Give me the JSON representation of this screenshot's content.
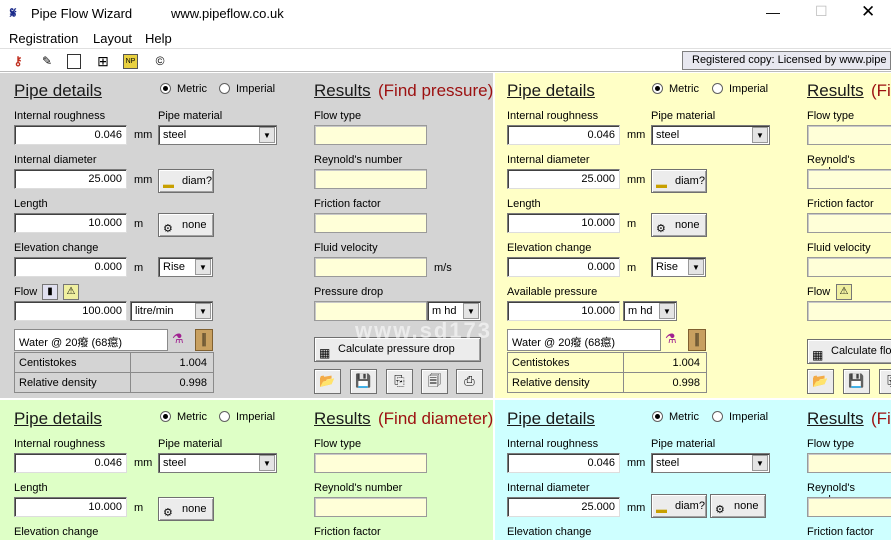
{
  "window": {
    "title": "Pipe Flow Wizard",
    "url": "www.pipeflow.co.uk"
  },
  "menu": {
    "items": [
      "Registration",
      "Layout",
      "Help"
    ]
  },
  "registered": "Registered copy: Licensed by www.pipe",
  "common": {
    "pipe_details": "Pipe details",
    "results": "Results",
    "metric": "Metric",
    "imperial": "Imperial",
    "internal_roughness": "Internal roughness",
    "pipe_material": "Pipe material",
    "internal_diameter": "Internal diameter",
    "length": "Length",
    "elevation_change": "Elevation change",
    "flow": "Flow",
    "available_pressure": "Available pressure",
    "flow_type": "Flow type",
    "reynolds": "Reynold's number",
    "friction": "Friction factor",
    "velocity": "Fluid velocity",
    "pressure_drop": "Pressure drop",
    "diam_btn": "diam?",
    "none_btn": "none",
    "centistokes": "Centistokes",
    "relative_density": "Relative density",
    "find_f": "(Fi"
  },
  "p1": {
    "subtitle": "(Find pressure)",
    "roughness": "0.046",
    "roughness_unit": "mm",
    "material": "steel",
    "diameter": "25.000",
    "diameter_unit": "mm",
    "length": "10.000",
    "length_unit": "m",
    "elevation": "0.000",
    "elevation_unit": "m",
    "elevation_dir": "Rise",
    "flow": "100.000",
    "flow_unit": "litre/min",
    "fluid": "Water @ 20癈 (68癋)",
    "centistokes": "1.004",
    "density": "0.998",
    "velocity_unit": "m/s",
    "pd_unit": "m hd",
    "calc_btn": "Calculate pressure drop"
  },
  "p2": {
    "roughness": "0.046",
    "roughness_unit": "mm",
    "material": "steel",
    "diameter": "25.000",
    "diameter_unit": "mm",
    "length": "10.000",
    "length_unit": "m",
    "elevation": "0.000",
    "elevation_unit": "m",
    "elevation_dir": "Rise",
    "pressure": "10.000",
    "pressure_unit": "m hd",
    "fluid": "Water @ 20癈 (68癋)",
    "centistokes": "1.004",
    "density": "0.998",
    "calc_btn": "Calculate flo"
  },
  "p3": {
    "subtitle": "(Find diameter)",
    "roughness": "0.046",
    "roughness_unit": "mm",
    "material": "steel",
    "length": "10.000",
    "length_unit": "m"
  },
  "p4": {
    "roughness": "0.046",
    "roughness_unit": "mm",
    "material": "steel",
    "diameter": "25.000",
    "diameter_unit": "mm"
  },
  "watermark": "www.sd173.com"
}
